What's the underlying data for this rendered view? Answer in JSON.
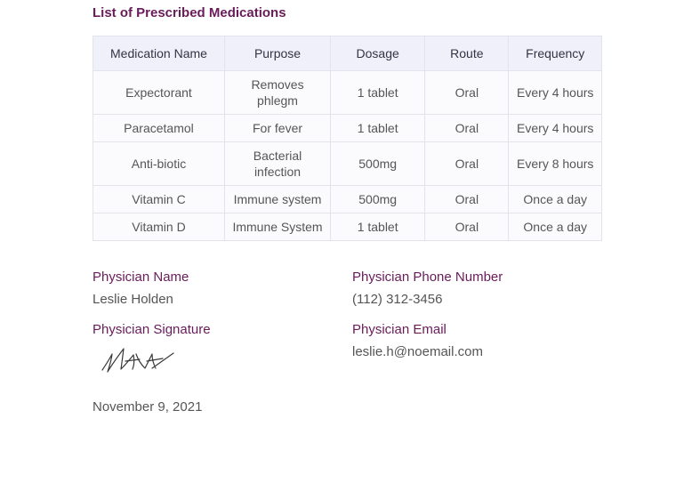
{
  "section_title": "List of Prescribed Medications",
  "table": {
    "headers": [
      "Medication Name",
      "Purpose",
      "Dosage",
      "Route",
      "Frequency"
    ],
    "rows": [
      [
        "Expectorant",
        "Removes phlegm",
        "1 tablet",
        "Oral",
        "Every 4 hours"
      ],
      [
        "Paracetamol",
        "For fever",
        "1 tablet",
        "Oral",
        "Every 4 hours"
      ],
      [
        "Anti-biotic",
        "Bacterial infection",
        "500mg",
        "Oral",
        "Every 8 hours"
      ],
      [
        "Vitamin C",
        "Immune system",
        "500mg",
        "Oral",
        "Once a day"
      ],
      [
        "Vitamin D",
        "Immune System",
        "1 tablet",
        "Oral",
        "Once a day"
      ]
    ]
  },
  "physician": {
    "name_label": "Physician Name",
    "name": "Leslie Holden",
    "phone_label": "Physician Phone Number",
    "phone": "(112) 312-3456",
    "signature_label": "Physician Signature",
    "email_label": "Physician Email",
    "email": "leslie.h@noemail.com"
  },
  "date": "November 9, 2021",
  "colors": {
    "accent": "#6a1b5a",
    "text": "#555555",
    "header_bg": "#f0f0fb",
    "border": "#e3e3ea"
  }
}
